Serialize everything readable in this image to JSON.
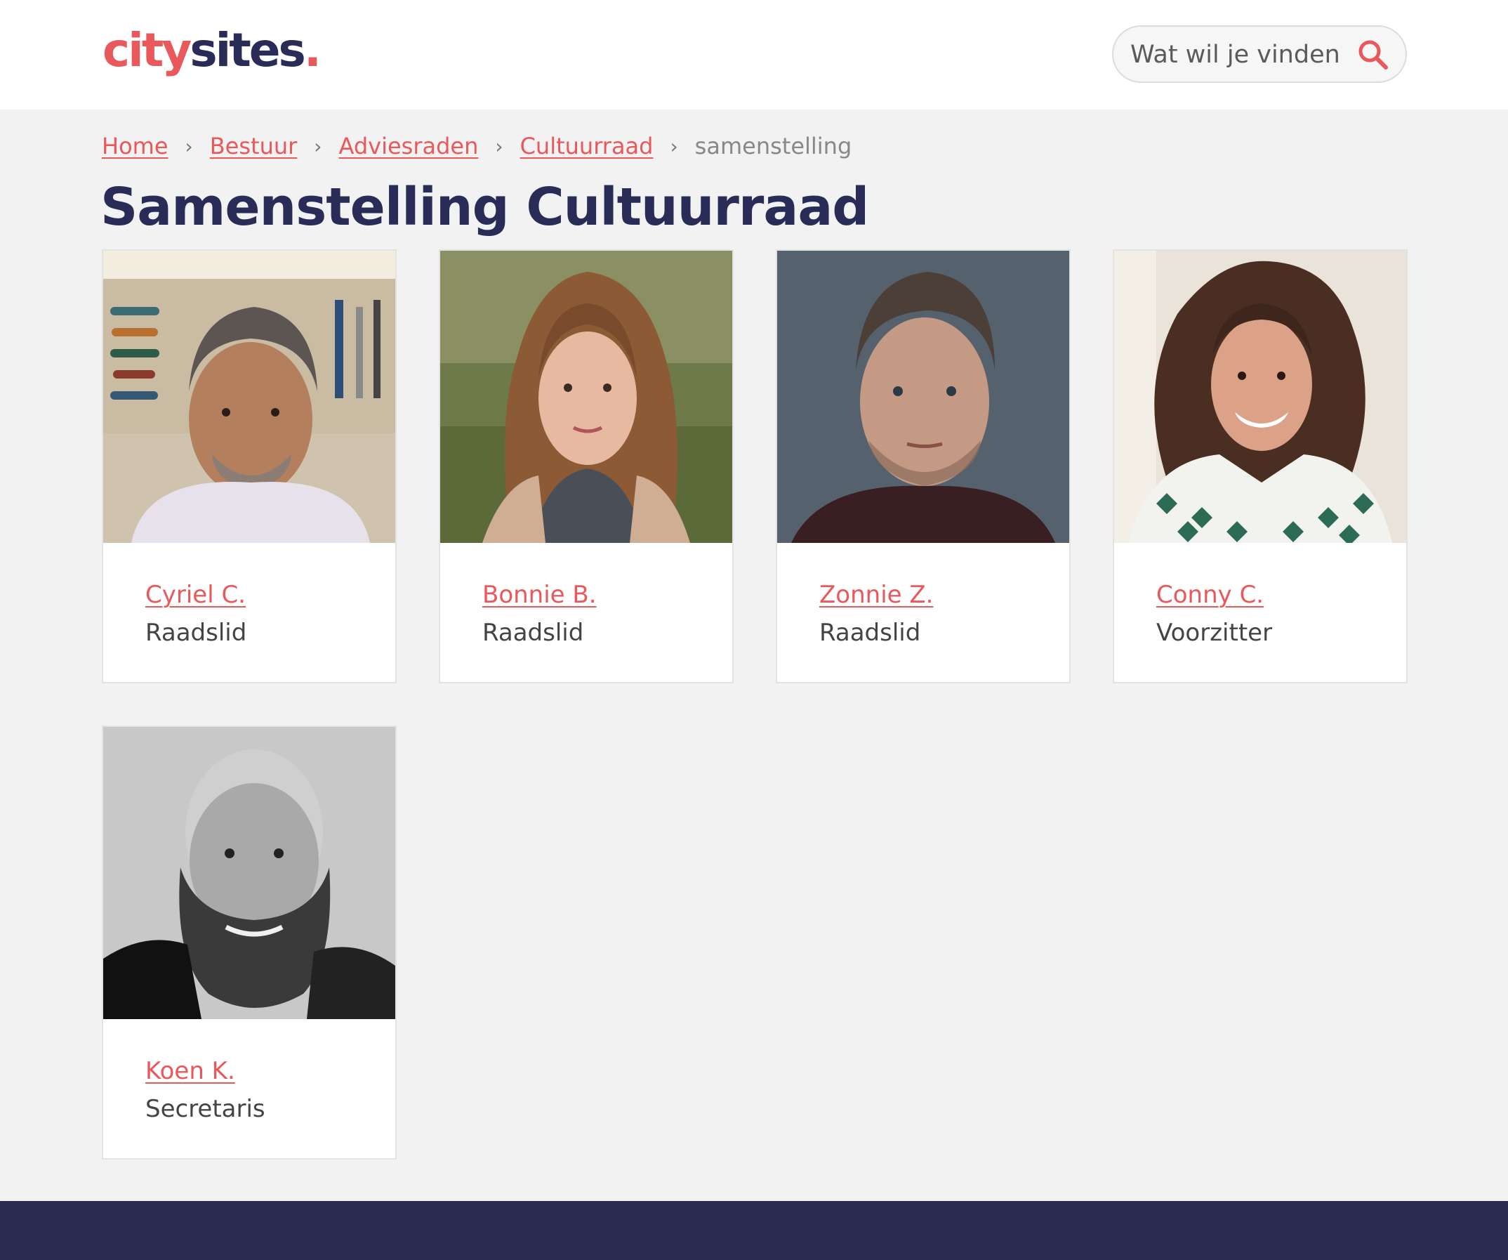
{
  "header": {
    "logo": {
      "city": "city",
      "sites": "sites",
      "dot": "."
    },
    "search": {
      "placeholder": "Wat wil je vinden",
      "icon": "search-icon"
    }
  },
  "breadcrumb": {
    "items": [
      "Home",
      "Bestuur",
      "Adviesraden",
      "Cultuurraad"
    ],
    "separator": "›",
    "current": "samenstelling"
  },
  "page": {
    "title": "Samenstelling Cultuurraad"
  },
  "members": [
    {
      "name": "Cyriel C.",
      "role": "Raadslid"
    },
    {
      "name": "Bonnie B.",
      "role": "Raadslid"
    },
    {
      "name": "Zonnie Z.",
      "role": "Raadslid"
    },
    {
      "name": "Conny C.",
      "role": "Voorzitter"
    },
    {
      "name": "Koen K.",
      "role": "Secretaris"
    }
  ],
  "colors": {
    "accent": "#e9585a",
    "brand_dark": "#282c57",
    "page_bg": "#f2f2f2",
    "footer_bg": "#2a2b52"
  }
}
